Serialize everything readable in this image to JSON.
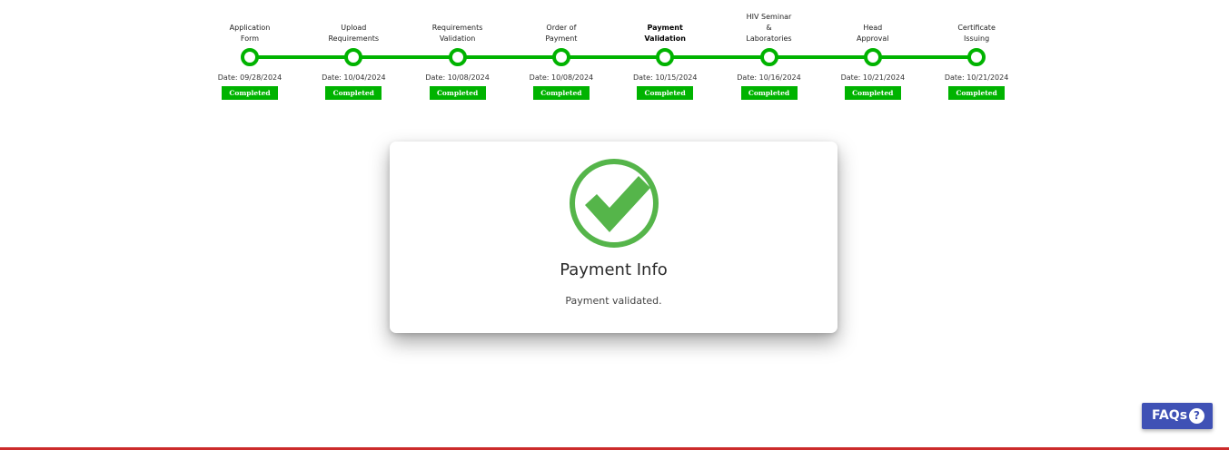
{
  "stepper": {
    "steps": [
      {
        "label": "Application\nForm",
        "date": "Date: 09/28/2024",
        "status": "Completed",
        "active": false
      },
      {
        "label": "Upload\nRequirements",
        "date": "Date: 10/04/2024",
        "status": "Completed",
        "active": false
      },
      {
        "label": "Requirements\nValidation",
        "date": "Date: 10/08/2024",
        "status": "Completed",
        "active": false
      },
      {
        "label": "Order of\nPayment",
        "date": "Date: 10/08/2024",
        "status": "Completed",
        "active": false
      },
      {
        "label": "Payment\nValidation",
        "date": "Date: 10/15/2024",
        "status": "Completed",
        "active": true
      },
      {
        "label": "HIV Seminar\n&\nLaboratories",
        "date": "Date: 10/16/2024",
        "status": "Completed",
        "active": false
      },
      {
        "label": "Head\nApproval",
        "date": "Date: 10/21/2024",
        "status": "Completed",
        "active": false
      },
      {
        "label": "Certificate\nIssuing",
        "date": "Date: 10/21/2024",
        "status": "Completed",
        "active": false
      }
    ],
    "accent_color": "#00b300"
  },
  "card": {
    "icon": "check-circle-icon",
    "icon_color": "#55b54a",
    "title": "Payment Info",
    "message": "Payment validated."
  },
  "faq": {
    "label": "FAQs",
    "icon": "question-circle-icon",
    "icon_glyph": "?",
    "color": "#3f51b5"
  }
}
